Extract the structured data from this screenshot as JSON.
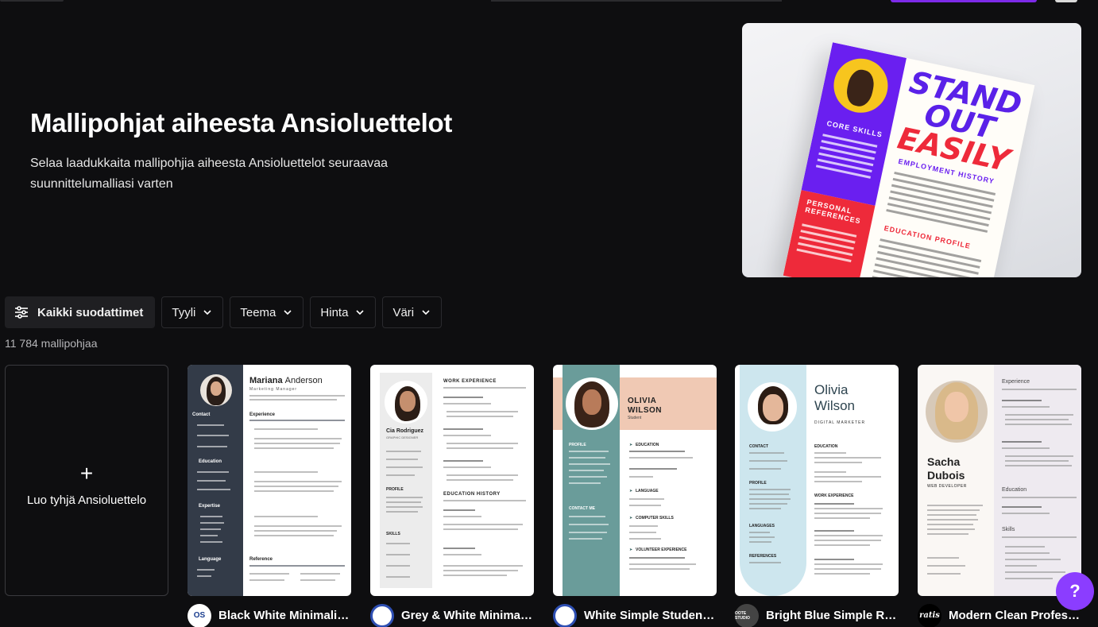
{
  "hero": {
    "title": "Mallipohjat aiheesta Ansioluettelot",
    "subtitle": "Selaa laadukkaita mallipohjia aiheesta Ansioluettelot seuraavaa suunnittelumalliasi varten",
    "image_text": {
      "headline_1": "STAND OUT",
      "headline_2": "EASILY",
      "core_skills": "CORE SKILLS",
      "employment": "EMPLOYMENT HISTORY",
      "references": "PERSONAL REFERENCES",
      "education": "EDUCATION PROFILE"
    }
  },
  "filters": {
    "all_label": "Kaikki suodattimet",
    "style_label": "Tyyli",
    "theme_label": "Teema",
    "price_label": "Hinta",
    "color_label": "Väri"
  },
  "result_count": "11 784 mallipohjaa",
  "create_card": {
    "plus": "+",
    "label": "Luo tyhjä Ansioluettelo"
  },
  "templates": [
    {
      "title": "Black White Minimalist...",
      "avatar_text": "OS",
      "name_first": "Mariana",
      "name_last": "Anderson",
      "role": "Marketing Manager",
      "sections": [
        "Contact",
        "Education",
        "Expertise",
        "Language",
        "Experience",
        "Reference"
      ]
    },
    {
      "title": "Grey & White Minimal ...",
      "avatar_text": "",
      "name": "Cia Rodriguez",
      "role": "GRAPHIC DESIGNER",
      "sections": [
        "WORK EXPERIENCE",
        "EDUCATION HISTORY",
        "PROFILE",
        "SKILLS"
      ]
    },
    {
      "title": "White Simple Student ...",
      "avatar_text": "",
      "name_first": "OLIVIA",
      "name_last": "WILSON",
      "role": "Student",
      "sections": [
        "EDUCATION",
        "LANGUAGE",
        "COMPUTER SKILLS",
        "VOLUNTEER EXPERIENCE",
        "PROFILE",
        "CONTACT ME"
      ]
    },
    {
      "title": "Bright Blue Simple Res...",
      "avatar_text": "OOTE STUDIO",
      "name_first": "Olivia",
      "name_last": "Wilson",
      "role": "DIGITAL MARKETER",
      "sections": [
        "CONTACT",
        "PROFILE",
        "LANGUAGES",
        "REFERENCES",
        "EDUCATION",
        "WORK EXPERIENCE"
      ]
    },
    {
      "title": "Modern Clean Professi...",
      "avatar_text": "ratis",
      "name_first": "Sacha",
      "name_last": "Dubois",
      "role": "WEB DEVELOPER",
      "sections": [
        "Experience",
        "Education",
        "Skills"
      ]
    }
  ],
  "help_button": "?",
  "colors": {
    "background": "#0e0e10",
    "accent": "#8b3dff",
    "chip_border": "#2a2a2e"
  }
}
